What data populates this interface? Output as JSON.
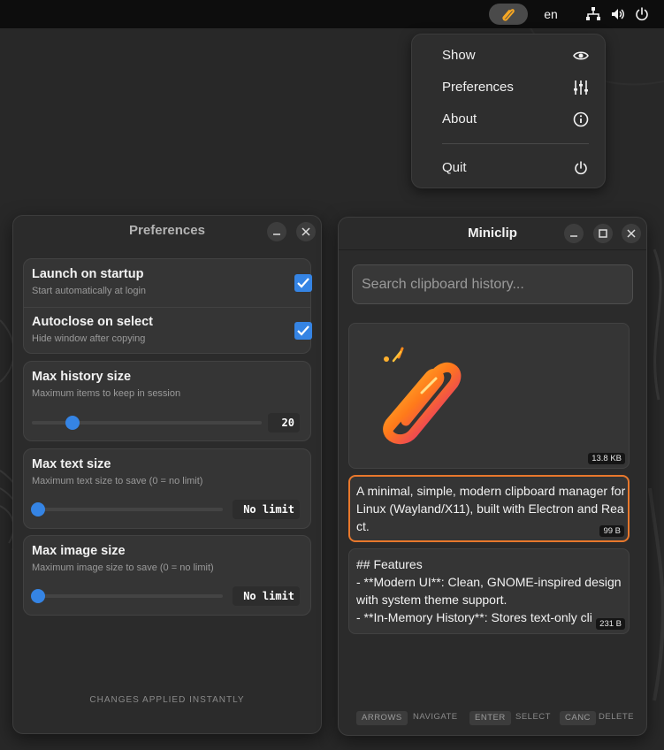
{
  "topbar": {
    "language": "en",
    "tray_app_icon": "paperclip-icon",
    "network_icon": "network-icon",
    "volume_icon": "volume-icon",
    "power_icon": "power-icon"
  },
  "tray_menu": {
    "items": [
      {
        "label": "Show",
        "icon": "eye-icon"
      },
      {
        "label": "Preferences",
        "icon": "sliders-icon"
      },
      {
        "label": "About",
        "icon": "info-icon"
      },
      {
        "label": "Quit",
        "icon": "power-icon"
      }
    ]
  },
  "preferences": {
    "title": "Preferences",
    "launch": {
      "title": "Launch on startup",
      "subtitle": "Start automatically at login",
      "checked": true
    },
    "autoclose": {
      "title": "Autoclose on select",
      "subtitle": "Hide window after copying",
      "checked": true
    },
    "history": {
      "title": "Max history size",
      "subtitle": "Maximum items to keep in session",
      "value": "20"
    },
    "text_size": {
      "title": "Max text size",
      "subtitle": "Maximum text size to save (0 = no limit)",
      "value": "No limit"
    },
    "image_size": {
      "title": "Max image size",
      "subtitle": "Maximum image size to save (0 = no limit)",
      "value": "No limit"
    },
    "footer": "CHANGES APPLIED INSTANTLY"
  },
  "miniclip": {
    "title": "Miniclip",
    "search_placeholder": "Search clipboard history...",
    "items": [
      {
        "type": "image",
        "size": "13.8 KB"
      },
      {
        "type": "text",
        "text": "A minimal, simple, modern clipboard manager for Linux (Wayland/X11), built with Electron and React.",
        "size": "99 B",
        "selected": true
      },
      {
        "type": "text",
        "text": "## Features\n- **Modern UI**: Clean, GNOME-inspired design with system theme support.\n- **In-Memory History**: Stores text-only cli",
        "size": "231 B"
      }
    ],
    "shortcuts": [
      {
        "key": "ARROWS",
        "action": "NAVIGATE"
      },
      {
        "key": "ENTER",
        "action": "SELECT"
      },
      {
        "key": "CANC",
        "action": "DELETE"
      }
    ]
  },
  "colors": {
    "accent": "#3584e4",
    "selection": "#e8782c",
    "window_bg": "#2b2b2b",
    "topbar_bg": "#0d0d0d"
  }
}
